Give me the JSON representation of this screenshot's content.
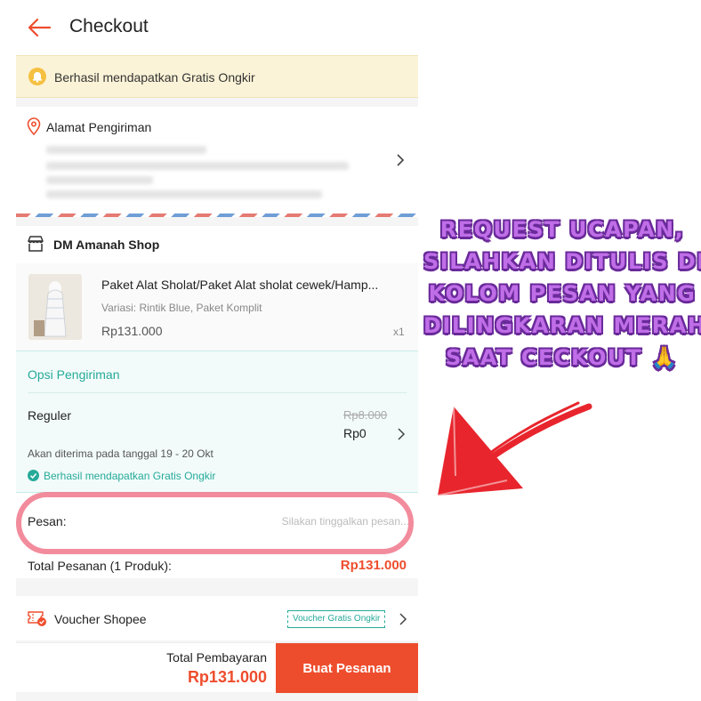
{
  "header": {
    "title": "Checkout"
  },
  "banner": {
    "text": "Berhasil mendapatkan Gratis Ongkir"
  },
  "address": {
    "title": "Alamat Pengiriman"
  },
  "shop": {
    "name": "DM Amanah Shop",
    "product": {
      "name": "Paket Alat Sholat/Paket Alat sholat cewek/Hamp...",
      "variant": "Variasi: Rintik Blue, Paket Komplit",
      "price": "Rp131.000",
      "quantity": "x1"
    },
    "shipping": {
      "title": "Opsi Pengiriman",
      "method": "Reguler",
      "original_price": "Rp8.000",
      "price": "Rp0",
      "eta": "Akan diterima pada tanggal 19 - 20 Okt",
      "free_shipping": "Berhasil mendapatkan Gratis Ongkir"
    },
    "message": {
      "label": "Pesan:",
      "placeholder": "Silakan tinggalkan pesan..."
    },
    "total": {
      "label": "Total Pesanan (1 Produk):",
      "value": "Rp131.000"
    }
  },
  "voucher": {
    "label": "Voucher Shopee",
    "tag": "Voucher Gratis Ongkir"
  },
  "footer": {
    "payment_label": "Total Pembayaran",
    "payment_value": "Rp131.000",
    "order_button": "Buat Pesanan"
  },
  "annotation": {
    "lines": [
      "Request ucapan,",
      "silahkan ditulis di",
      "kolom pesan yang",
      "dilingkaran merah",
      "saat ceckout 🙏"
    ]
  },
  "colors": {
    "accent": "#ee4d2d",
    "teal": "#26aa99",
    "banner_bg": "#fbf3d7",
    "annotation": "#c06ee8",
    "highlight_circle": "#f0788c"
  },
  "icons": [
    "back-arrow-icon",
    "bell-icon",
    "location-pin-icon",
    "chevron-right-icon",
    "store-icon",
    "check-circle-icon",
    "voucher-icon",
    "red-arrow"
  ]
}
